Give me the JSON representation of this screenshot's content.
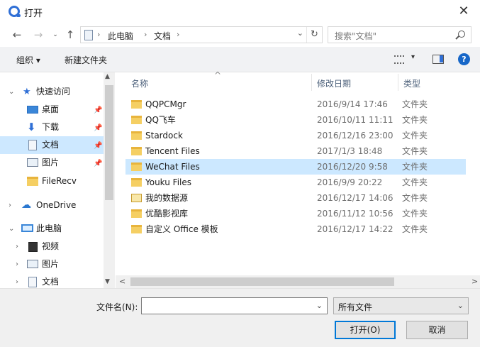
{
  "window": {
    "title": "打开",
    "close": "✕"
  },
  "nav": {
    "back": "←",
    "forward": "→",
    "recent": "⌄",
    "up": "↑"
  },
  "address": {
    "sep": "›",
    "crumbs": [
      "此电脑",
      "文档"
    ],
    "dropdown": "⌄",
    "refresh": "↻"
  },
  "search": {
    "placeholder": "搜索\"文档\""
  },
  "toolbar": {
    "organize": "组织 ▾",
    "new_folder": "新建文件夹",
    "view_drop": "▾",
    "help": "?"
  },
  "sidebar": {
    "expand": "›",
    "collapse": "⌄",
    "pin": "📌",
    "quick_access": "快速访问",
    "desktop": "桌面",
    "downloads": "下载",
    "documents": "文档",
    "pictures": "图片",
    "filerecv": "FileRecv",
    "onedrive": "OneDrive",
    "this_pc": "此电脑",
    "videos": "视频",
    "pictures2": "图片",
    "documents2": "文档",
    "star": "★",
    "download_arrow": "⬇",
    "cloud": "☁"
  },
  "scroll": {
    "up": "▲",
    "down": "▼",
    "left": "<",
    "right": ">"
  },
  "columns": {
    "name": "名称",
    "date": "修改日期",
    "type": "类型",
    "sort": "^"
  },
  "files": [
    {
      "name": "QQPCMgr",
      "date": "2016/9/14 17:46",
      "type": "文件夹"
    },
    {
      "name": "QQ飞车",
      "date": "2016/10/11 11:11",
      "type": "文件夹"
    },
    {
      "name": "Stardock",
      "date": "2016/12/16 23:00",
      "type": "文件夹"
    },
    {
      "name": "Tencent Files",
      "date": "2017/1/3 18:48",
      "type": "文件夹"
    },
    {
      "name": "WeChat Files",
      "date": "2016/12/20 9:58",
      "type": "文件夹"
    },
    {
      "name": "Youku Files",
      "date": "2016/9/9 20:22",
      "type": "文件夹"
    },
    {
      "name": "我的数据源",
      "date": "2016/12/17 14:06",
      "type": "文件夹"
    },
    {
      "name": "优酷影视库",
      "date": "2016/11/12 10:56",
      "type": "文件夹"
    },
    {
      "name": "自定义 Office 模板",
      "date": "2016/12/17 14:22",
      "type": "文件夹"
    }
  ],
  "bottom": {
    "filename_label": "文件名(N):",
    "filename_value": "",
    "dropdown": "⌄",
    "filetype": "所有文件",
    "open": "打开(O)",
    "cancel": "取消"
  }
}
